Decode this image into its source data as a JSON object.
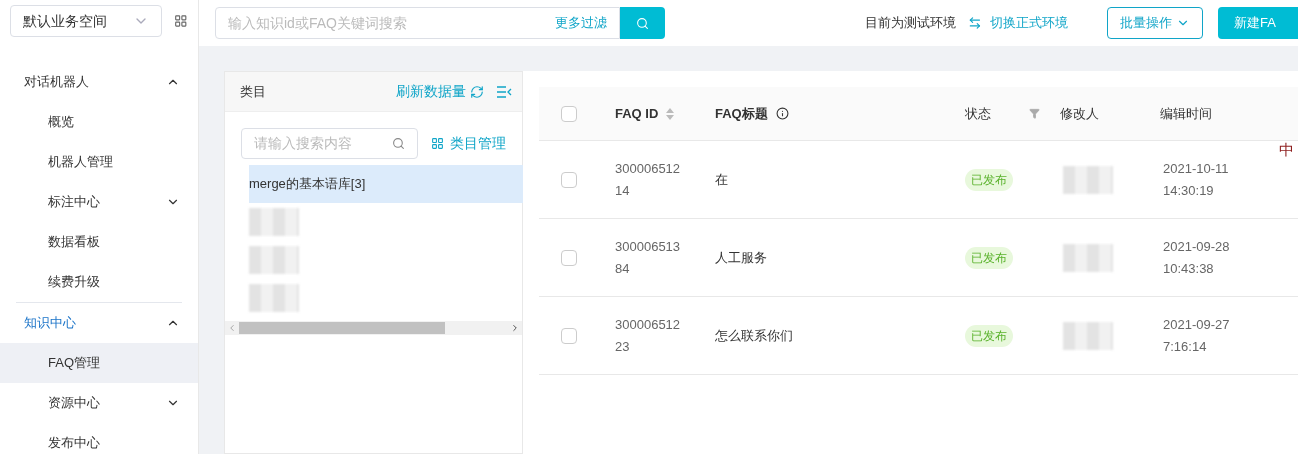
{
  "workspace_select": {
    "value": "默认业务空间"
  },
  "sidebar": {
    "groups": [
      {
        "label": "对话机器人",
        "expanded": true,
        "active": false,
        "items": [
          {
            "label": "概览",
            "selected": false,
            "has_children": false
          },
          {
            "label": "机器人管理",
            "selected": false,
            "has_children": false
          },
          {
            "label": "标注中心",
            "selected": false,
            "has_children": true
          },
          {
            "label": "数据看板",
            "selected": false,
            "has_children": false
          },
          {
            "label": "续费升级",
            "selected": false,
            "has_children": false
          }
        ]
      },
      {
        "label": "知识中心",
        "expanded": true,
        "active": true,
        "items": [
          {
            "label": "FAQ管理",
            "selected": true,
            "has_children": false
          },
          {
            "label": "资源中心",
            "selected": false,
            "has_children": true
          },
          {
            "label": "发布中心",
            "selected": false,
            "has_children": false
          }
        ]
      }
    ]
  },
  "search": {
    "placeholder": "输入知识id或FAQ关键词搜索",
    "filter_link": "更多过滤"
  },
  "env": {
    "text": "目前为测试环境",
    "switch_link": "切换正式环境"
  },
  "buttons": {
    "batch": "批量操作",
    "create": "新建FA"
  },
  "category_panel": {
    "title": "类目",
    "refresh": "刷新数据量",
    "search_placeholder": "请输入搜索内容",
    "manage": "类目管理",
    "items": [
      {
        "label": "merge的基本语库[3]",
        "selected": true,
        "kind": "text"
      },
      {
        "kind": "redacted",
        "selected": false
      },
      {
        "kind": "redacted",
        "selected": false
      },
      {
        "kind": "redacted",
        "selected": false
      }
    ]
  },
  "table": {
    "select_all_checked": false,
    "columns": [
      "FAQ ID",
      "FAQ标题",
      "状态",
      "修改人",
      "编辑时间"
    ],
    "rows": [
      {
        "id": "300006512\n14",
        "title": "在",
        "status": "已发布",
        "time": "2021-10-11\n14:30:19",
        "checked": false
      },
      {
        "id": "300006513\n84",
        "title": "人工服务",
        "status": "已发布",
        "time": "2021-09-28\n10:43:38",
        "checked": false
      },
      {
        "id": "300006512\n23",
        "title": "怎么联系你们",
        "status": "已发布",
        "time": "2021-09-27\n7:16:14",
        "checked": false
      }
    ]
  },
  "floating_widget": {
    "text": "中"
  }
}
